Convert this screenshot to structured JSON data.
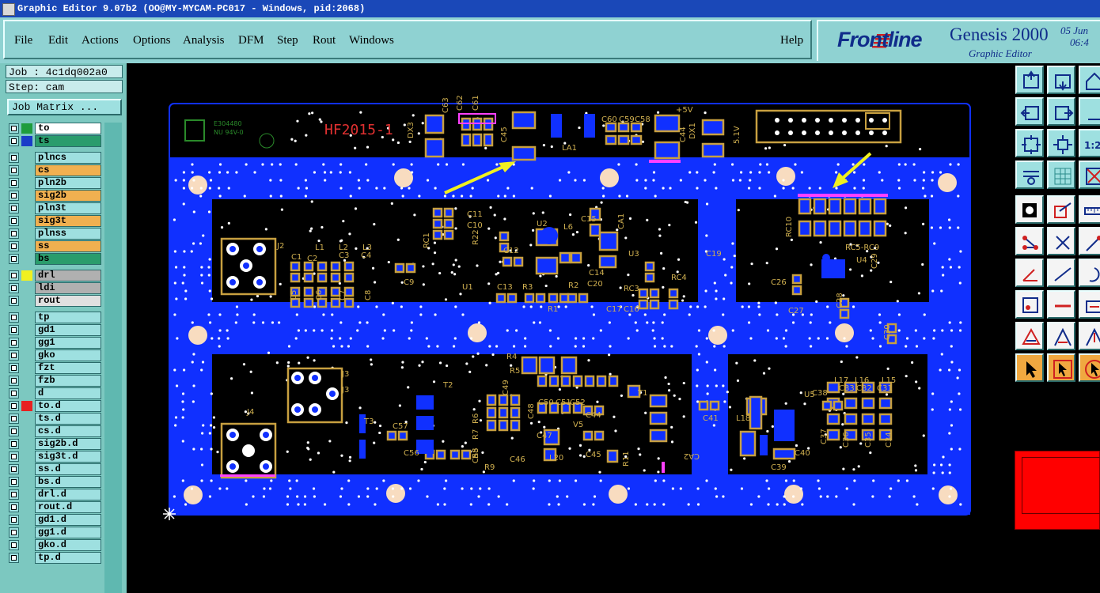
{
  "window": {
    "title": "Graphic Editor 9.07b2 (OO@MY-MYCAM-PC017 - Windows, pid:2068)"
  },
  "menu": {
    "items": [
      "File",
      "Edit",
      "Actions",
      "Options",
      "Analysis",
      "DFM",
      "Step",
      "Rout",
      "Windows"
    ],
    "help": "Help"
  },
  "brand": {
    "logo": "Frontline",
    "product": "Genesis 2000",
    "subtitle": "Graphic Editor",
    "date": "05 Jun",
    "time": "06:4"
  },
  "job": {
    "job_line": "Job : 4c1dq002a0",
    "step_line": "Step: cam",
    "matrix_button": "Job Matrix ..."
  },
  "layers": [
    {
      "name": "to",
      "color": "#1a3cc8",
      "swatch": "#1e9c3c",
      "bg": "#ffffff",
      "group": 0
    },
    {
      "name": "ts",
      "color": "#1a3cc8",
      "swatch": "#1a3cc8",
      "bg": "#2a9c6c",
      "group": 0
    },
    {
      "name": "plncs",
      "color": "",
      "swatch": "",
      "bg": "#9ee0e0",
      "group": 1
    },
    {
      "name": "cs",
      "color": "",
      "swatch": "",
      "bg": "#f0b050",
      "group": 1
    },
    {
      "name": "pln2b",
      "color": "",
      "swatch": "",
      "bg": "#9ee0e0",
      "group": 1
    },
    {
      "name": "sig2b",
      "color": "",
      "swatch": "",
      "bg": "#f0b050",
      "group": 1
    },
    {
      "name": "pln3t",
      "color": "",
      "swatch": "",
      "bg": "#9ee0e0",
      "group": 1
    },
    {
      "name": "sig3t",
      "color": "",
      "swatch": "",
      "bg": "#f0b050",
      "group": 1
    },
    {
      "name": "plnss",
      "color": "",
      "swatch": "",
      "bg": "#9ee0e0",
      "group": 1
    },
    {
      "name": "ss",
      "color": "",
      "swatch": "",
      "bg": "#f0b050",
      "group": 1
    },
    {
      "name": "bs",
      "color": "",
      "swatch": "",
      "bg": "#2a9c6c",
      "group": 1
    },
    {
      "name": "drl",
      "color": "",
      "swatch": "#f0f020",
      "bg": "#b0b0b0",
      "group": 2
    },
    {
      "name": "ldi",
      "color": "",
      "swatch": "",
      "bg": "#b0b0b0",
      "group": 2
    },
    {
      "name": "rout",
      "color": "",
      "swatch": "",
      "bg": "#e0e0e0",
      "group": 2
    },
    {
      "name": "tp",
      "color": "",
      "swatch": "",
      "bg": "#9ee0e0",
      "group": 3
    },
    {
      "name": "gd1",
      "color": "",
      "swatch": "",
      "bg": "#9ee0e0",
      "group": 3
    },
    {
      "name": "gg1",
      "color": "",
      "swatch": "",
      "bg": "#9ee0e0",
      "group": 3
    },
    {
      "name": "gko",
      "color": "",
      "swatch": "",
      "bg": "#9ee0e0",
      "group": 3
    },
    {
      "name": "fzt",
      "color": "",
      "swatch": "",
      "bg": "#9ee0e0",
      "group": 3
    },
    {
      "name": "fzb",
      "color": "",
      "swatch": "",
      "bg": "#9ee0e0",
      "group": 3
    },
    {
      "name": "d",
      "color": "",
      "swatch": "",
      "bg": "#9ee0e0",
      "group": 3
    },
    {
      "name": "to.d",
      "color": "",
      "swatch": "#e82020",
      "bg": "#9ee0e0",
      "group": 3
    },
    {
      "name": "ts.d",
      "color": "",
      "swatch": "",
      "bg": "#9ee0e0",
      "group": 3
    },
    {
      "name": "cs.d",
      "color": "",
      "swatch": "",
      "bg": "#9ee0e0",
      "group": 3
    },
    {
      "name": "sig2b.d",
      "color": "",
      "swatch": "",
      "bg": "#9ee0e0",
      "group": 3
    },
    {
      "name": "sig3t.d",
      "color": "",
      "swatch": "",
      "bg": "#9ee0e0",
      "group": 3
    },
    {
      "name": "ss.d",
      "color": "",
      "swatch": "",
      "bg": "#9ee0e0",
      "group": 3
    },
    {
      "name": "bs.d",
      "color": "",
      "swatch": "",
      "bg": "#9ee0e0",
      "group": 3
    },
    {
      "name": "drl.d",
      "color": "",
      "swatch": "",
      "bg": "#9ee0e0",
      "group": 3
    },
    {
      "name": "rout.d",
      "color": "",
      "swatch": "",
      "bg": "#9ee0e0",
      "group": 3
    },
    {
      "name": "gd1.d",
      "color": "",
      "swatch": "",
      "bg": "#9ee0e0",
      "group": 3
    },
    {
      "name": "gg1.d",
      "color": "",
      "swatch": "",
      "bg": "#9ee0e0",
      "group": 3
    },
    {
      "name": "gko.d",
      "color": "",
      "swatch": "",
      "bg": "#9ee0e0",
      "group": 3
    },
    {
      "name": "tp.d",
      "color": "",
      "swatch": "",
      "bg": "#9ee0e0",
      "group": 3
    }
  ],
  "board": {
    "marking": "HF2015-1",
    "logo_text_1": "E304480",
    "logo_text_2": "NU 94V-0",
    "labels": [
      "DX3",
      "C63",
      "C62",
      "C61",
      "C45",
      "LA1",
      "C60",
      "C59",
      "C58",
      "C44",
      "DX1",
      "+5V",
      "5.1V",
      "J2",
      "L1",
      "C1",
      "C2",
      "L2",
      "C3",
      "L3",
      "C4",
      "C5",
      "C6",
      "C7",
      "C8",
      "C9",
      "RC1",
      "C11",
      "C10",
      "R22",
      "U1",
      "U2",
      "L6",
      "C15",
      "CA1",
      "C12",
      "C13",
      "R3",
      "R1",
      "R2",
      "C14",
      "C20",
      "C17",
      "C16",
      "U3",
      "RC3",
      "RC4",
      "C18",
      "C26",
      "C27",
      "C28",
      "RC10",
      "RC5-RC9",
      "U4",
      "C29",
      "C30",
      "C19",
      "T2",
      "J3",
      "J4",
      "T3",
      "C57",
      "C56",
      "C55",
      "C49",
      "C48",
      "C50",
      "C51",
      "C52",
      "C47",
      "C46",
      "L20",
      "R9",
      "R4",
      "R5",
      "R6",
      "R7",
      "R8",
      "T1",
      "C44",
      "V5",
      "C45",
      "R11",
      "C41",
      "CA2",
      "L18",
      "C39",
      "C40",
      "C38",
      "L17",
      "L16",
      "L15",
      "C33",
      "C32",
      "C31",
      "U5",
      "C37",
      "C36",
      "C35",
      "C34"
    ],
    "colors": {
      "fill": "#1030ff",
      "pad": "#c8a040",
      "outline": "#b8a050",
      "hole": "#f8dcc0",
      "label": "#d0b050",
      "marking": "#e03030",
      "arrow": "#f0f020",
      "accent": "#ff40ff"
    }
  },
  "tools": {
    "icons": [
      "home-view-icon",
      "redraw-icon",
      "house-icon",
      "pan-left-icon",
      "pan-right-icon",
      "scale-icon",
      "fit-icon",
      "center-icon",
      "zoom-1-2-icon",
      "settings-icon",
      "grid-icon",
      "snap-icon",
      "fill-mode-icon",
      "shape-edit-icon",
      "measure-icon",
      "connect-icon",
      "cut-icon",
      "arrow-icon",
      "line-angle-icon",
      "line-icon",
      "arc-icon",
      "point-icon",
      "dash-icon",
      "box-icon",
      "triangle-icon",
      "peak-icon",
      "peak-arrow-icon",
      "pointer-icon",
      "pointer-box-icon",
      "pointer-circle-icon"
    ]
  }
}
